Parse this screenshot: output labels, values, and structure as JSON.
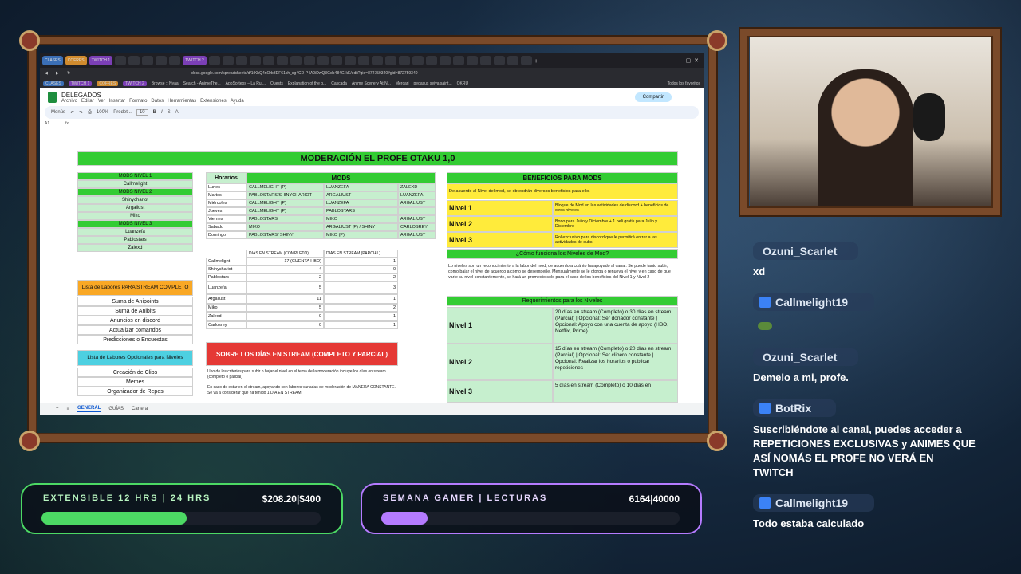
{
  "browser": {
    "tabs": [
      "CLASES",
      "COFRES",
      "TWITCH 1",
      "TWITCH 2"
    ],
    "url": "docs.google.com/spreadsheets/d/1fKhQ4nOrb3DF61ch_sg4CD-P4A0iDwQ3Gdb484G-kE/edit?gid=872759340#gid=872759340",
    "bookmarks": [
      "CLASES",
      "TWITCH 1",
      "COFRES",
      "TWITCH 2",
      "Browse :: Nyaa",
      "Search - AnimeThe...",
      "AppSorteos – La Rul...",
      "Quests",
      "Explanation of the p...",
      "Cascada",
      "Anime Scenery At N...",
      "Mercari",
      "pegasus seiya saint...",
      "OKRU",
      "Todos los favoritos"
    ]
  },
  "doc": {
    "title": "DELEGADOS",
    "menus": [
      "Archivo",
      "Editar",
      "Ver",
      "Insertar",
      "Formato",
      "Datos",
      "Herramientas",
      "Extensiones",
      "Ayuda"
    ],
    "share": "Compartir",
    "toolbar": {
      "menus": "Menús",
      "zoom": "100%",
      "font": "Predet...",
      "size": "10"
    },
    "cell_ref": "A1",
    "fx": "fx"
  },
  "sheet": {
    "title": "MODERACIÓN EL PROFE OTAKU 1,0",
    "mods_nivel": [
      {
        "label": "MODS NIVEL 1",
        "type": "h"
      },
      {
        "label": "Callmelight",
        "type": "n"
      },
      {
        "label": "MODS NIVEL 2",
        "type": "h"
      },
      {
        "label": "Shinychariot",
        "type": "n"
      },
      {
        "label": "Argaliust",
        "type": "n"
      },
      {
        "label": "Miko",
        "type": "n"
      },
      {
        "label": "MODS NIVEL 3",
        "type": "h"
      },
      {
        "label": "Luanzefa",
        "type": "n"
      },
      {
        "label": "Pablostars",
        "type": "n"
      },
      {
        "label": "Zalexd",
        "type": "n"
      }
    ],
    "horarios_header": "Horarios",
    "mods_header": "MODS",
    "horarios": [
      [
        "Lunes",
        "CALLMELIGHT (P)",
        "LUANZEFA",
        "ZALEXD"
      ],
      [
        "Martes",
        "PABLOSTARS/SHINYCHARIOT",
        "ARGALIUST",
        "LUANZEFA"
      ],
      [
        "Miércoles",
        "CALLMELIGHT (P)",
        "LUANZEFA",
        "ARGALIUST"
      ],
      [
        "Jueves",
        "CALLMELIGHT (P)",
        "PABLOSTARS",
        ""
      ],
      [
        "Viernes",
        "PABLOSTARS",
        "MIKO",
        "ARGALIUST"
      ],
      [
        "Sabado",
        "MIKO",
        "ARGALIUST (P) / SHINY",
        "CARLOSREY"
      ],
      [
        "Domingo",
        "PABLOSTARS/ SHINY",
        "MIKO (P)",
        "ARGALIUST"
      ]
    ],
    "dias_headers": [
      "DIAS EN STREAM (COMPLETO)",
      "DIAS EN STREAM (PARCIAL)"
    ],
    "dias": [
      [
        "Callmelight",
        "17 (CUENTA HBO)",
        "1"
      ],
      [
        "Shinychariot",
        "4",
        "0"
      ],
      [
        "Pablostars",
        "2",
        "2"
      ],
      [
        "Luanzefa",
        "5",
        "3"
      ],
      [
        "Argaliust",
        "11",
        "1"
      ],
      [
        "Miko",
        "5",
        "2"
      ],
      [
        "Zalexd",
        "0",
        "1"
      ],
      [
        "Carlosrey",
        "0",
        "1"
      ]
    ],
    "labores_title": "Lista de Labores PARA STREAM COMPLETO",
    "labores": [
      "Suma de Anipoints",
      "Suma de Anibits",
      "Anuncios en discord",
      "Actualizar comandos",
      "Predicciones o Encuestas"
    ],
    "opcionales_title": "Lista de Labores Opcionales para Niveles",
    "opcionales": [
      "Creación de Clips",
      "Memes",
      "Organizador de Repes"
    ],
    "sobre_title": "SOBRE LOS DÍAS EN STREAM (COMPLETO Y PARCIAL)",
    "sobre_text1": "Uno de los criterios para subir o bajar el nivel en el tema de la moderación incluye los días en stream (completo o parcial)",
    "sobre_text2": "En caso de estar en el stream, apoyando con labores variadas de moderación de MANERA CONSTANTE.. Se va a considerar que ha tenido 1 DÍA EN STREAM",
    "beneficios_title": "BENEFICIOS PARA MODS",
    "beneficios_intro": "De acuerdo al Nivel del mod, se obtendrán diversos beneficios para ello.",
    "beneficios": [
      [
        "Nivel 1",
        "Bloque de Mod en las actividades de discord + beneficios de otros niveles"
      ],
      [
        "Nivel 2",
        "Bono para Julio y Diciembre + 1 peli gratis para Julio y Diciembre"
      ],
      [
        "Nivel 3",
        "Rol exclusivo para discord que le permitirá entrar a las actividades de subs"
      ]
    ],
    "como_title": "¿Cómo funciona los Niveles de Mod?",
    "como_text": "Lo niveles son un reconocimiento a la labor del mod, de acuerdo a cuánto ha apoyado al canal. Se puede tanto subir, como bajar el nivel de acuerdo a cómo se desempeñe. Mensualmente se le otorga o renueva el nivel y en caso de que varíe su nivel constantemente, se hará un promedio solo para el caso de los beneficios del Nivel 1 y Nivel 2",
    "req_title": "Requerimientos para los Niveles",
    "req": [
      [
        "Nivel 1",
        "20 días en stream (Completo) o 30 días en stream (Parcial) | Opcional: Ser donador constante | Opcional: Apoyo con una cuenta de apoyo (HBO, Netflix, Prime)"
      ],
      [
        "Nivel 2",
        "15 días en stream (Completo) o 20 días en stream (Parcial) | Opcional: Ser clipero constante | Opcional: Realizar los horarios o publicar repeticiones"
      ],
      [
        "Nivel 3",
        "5 días en stream (Completo) o 10 días en"
      ]
    ],
    "tabs": [
      "GENERAL",
      "GUÍAS",
      "Cartera"
    ]
  },
  "chat": [
    {
      "user": "Ozuni_Scarlet",
      "msg": "xd"
    },
    {
      "user": "Callmelight19",
      "msg": ""
    },
    {
      "user": "Ozuni_Scarlet",
      "msg": "Demelo a mi, profe."
    },
    {
      "user": "BotRix",
      "msg": "Suscribiéndote al canal, puedes acceder a REPETICIONES EXCLUSIVAS y ANIMES QUE ASÍ NOMÁS EL PROFE NO VERÁ EN TWITCH"
    },
    {
      "user": "Callmelight19",
      "msg": "Todo estaba calculado"
    }
  ],
  "goals": [
    {
      "title": "EXTENSIBLE 12 HRS | 24 HRS",
      "value": "$208.20|$400",
      "progress": 0.52,
      "color": "#4cd964"
    },
    {
      "title": "SEMANA GAMER | LECTURAS",
      "value": "6164|40000",
      "progress": 0.154,
      "color": "#b57bff"
    }
  ]
}
